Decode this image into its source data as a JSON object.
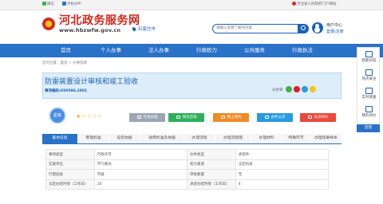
{
  "topbar": {
    "weibo": "微信",
    "mobile_app": "手机APP",
    "portal_link": "河北省人民政府门户网站"
  },
  "header": {
    "site_name": "河北政务服务网",
    "site_url": "www.hbzwfw.gov.cn",
    "city": "石家庄市",
    "search_placeholder": "请输入您想了解的内容",
    "user_center": "用户中心",
    "login_links": "登录|注册"
  },
  "nav": {
    "items": [
      "首页",
      "个人办事",
      "法人办事",
      "行政权力",
      "公共服务",
      "行政执法"
    ]
  },
  "breadcrumb": {
    "prefix": "您的位置：",
    "home": "首页",
    "sep": " > ",
    "current": "办事指南"
  },
  "service": {
    "title": "防雷装置设计审核和竣工验收",
    "code_label": "事项编码:",
    "code": "0X0596,2001",
    "share_label": "分享到"
  },
  "rating": {
    "badge": "星级",
    "stars": "★☆☆☆☆"
  },
  "actions": [
    {
      "label": "在线办理",
      "color": "#9aa6b4"
    },
    {
      "label": "情况咨询",
      "color": "#2fb05a"
    },
    {
      "label": "网上预约",
      "color": "#f08a24"
    },
    {
      "label": "办件公示",
      "color": "#2a9ae0"
    },
    {
      "label": "投诉评价",
      "color": "#e84a3c"
    }
  ],
  "tabs": [
    "基本信息",
    "受理标准",
    "设定依据",
    "收费标准及依据",
    "办理流程",
    "办理流程图",
    "办理材料",
    "特殊环节",
    "办理结果样本"
  ],
  "table": {
    "rows": [
      {
        "k1": "事项类型",
        "v1": "行政许可",
        "k2": "办件类型",
        "v2": "承诺件"
      },
      {
        "k1": "实施单位",
        "v1": "市气象局",
        "k2": "权力来源",
        "v2": "法定机关"
      },
      {
        "k1": "行使层级",
        "v1": "市级",
        "k2": "审批数量",
        "v2": "无"
      },
      {
        "k1": "法定办结时限（工作日）",
        "v1": "20",
        "k2": "承诺办结时限（工作日）",
        "v2": "4"
      }
    ]
  },
  "sidebar": {
    "items": [
      "智能问答",
      "热点关注",
      "实时调查",
      "我的评价"
    ],
    "feedback": "反馈"
  }
}
